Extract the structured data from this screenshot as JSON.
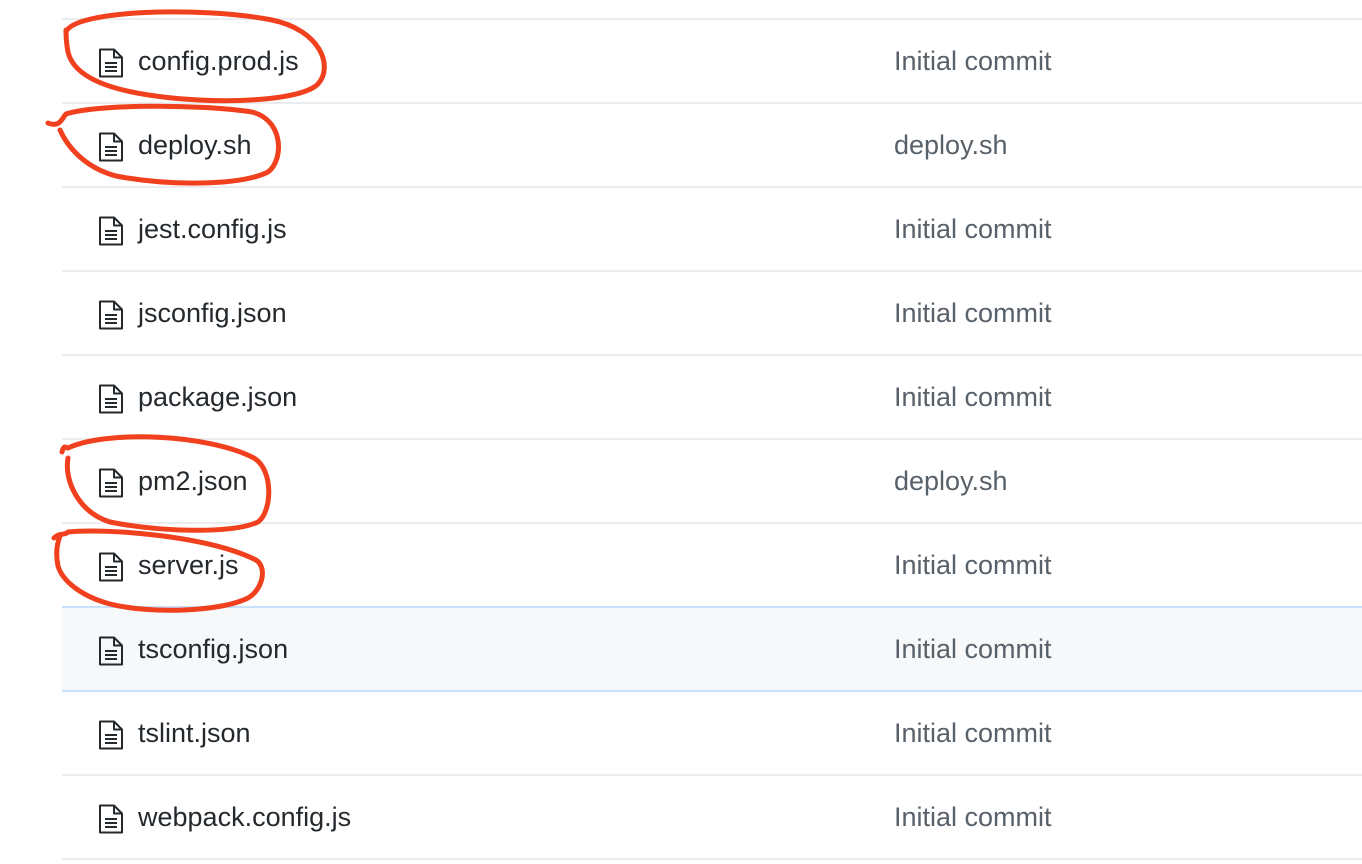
{
  "files": [
    {
      "name": "config.prod.js",
      "commit": "Initial commit",
      "icon": "file-text-icon",
      "annotated": true
    },
    {
      "name": "deploy.sh",
      "commit": "deploy.sh",
      "icon": "file-text-icon",
      "annotated": true
    },
    {
      "name": "jest.config.js",
      "commit": "Initial commit",
      "icon": "file-text-icon",
      "annotated": false
    },
    {
      "name": "jsconfig.json",
      "commit": "Initial commit",
      "icon": "file-text-icon",
      "annotated": false
    },
    {
      "name": "package.json",
      "commit": "Initial commit",
      "icon": "file-text-icon",
      "annotated": false
    },
    {
      "name": "pm2.json",
      "commit": "deploy.sh",
      "icon": "file-text-icon",
      "annotated": true
    },
    {
      "name": "server.js",
      "commit": "Initial commit",
      "icon": "file-text-icon",
      "annotated": true
    },
    {
      "name": "tsconfig.json",
      "commit": "Initial commit",
      "icon": "file-text-icon",
      "annotated": false,
      "hovered": true
    },
    {
      "name": "tslint.json",
      "commit": "Initial commit",
      "icon": "file-text-icon",
      "annotated": false
    },
    {
      "name": "webpack.config.js",
      "commit": "Initial commit",
      "icon": "file-text-icon",
      "annotated": false
    }
  ],
  "colors": {
    "annotation": "#f0401e",
    "hover_bg": "#f6f8fa",
    "hover_border": "#c8e1ff",
    "row_border": "#eaecef",
    "file_name": "#24292e",
    "commit_message": "#586069"
  }
}
